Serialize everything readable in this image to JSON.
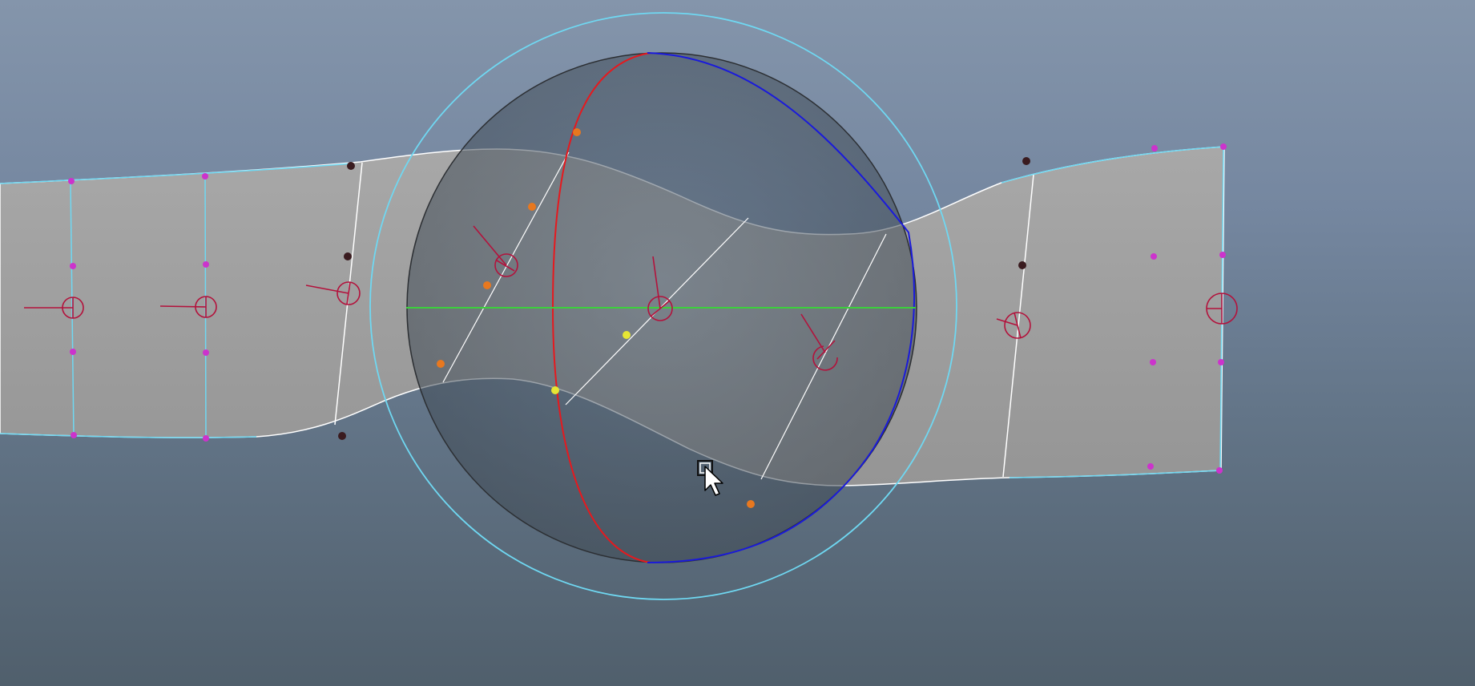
{
  "viewport": {
    "background_top": "#8495ab",
    "background_bottom": "#505f6c"
  },
  "colors": {
    "surface": "#a3a3a3",
    "surface_shadow": "#8a8a8a",
    "isoparm": "#ffffff",
    "hull_cyan": "#6fd8f2",
    "cv_magenta": "#cc33cc",
    "joint_red": "#b3123c",
    "manip_red": "#e6191e",
    "manip_blue": "#1a1adb",
    "manip_green": "#3bd13b",
    "manip_outer_cyan": "#6fd8f2",
    "manip_sphere": "#4c5a68",
    "orange_point": "#e8781f",
    "yellow_point": "#e6e633",
    "dark_point": "#3a1b1f"
  },
  "icons": {
    "cursor": "arrow-cursor-icon",
    "move_handle": "square-handle-icon"
  }
}
